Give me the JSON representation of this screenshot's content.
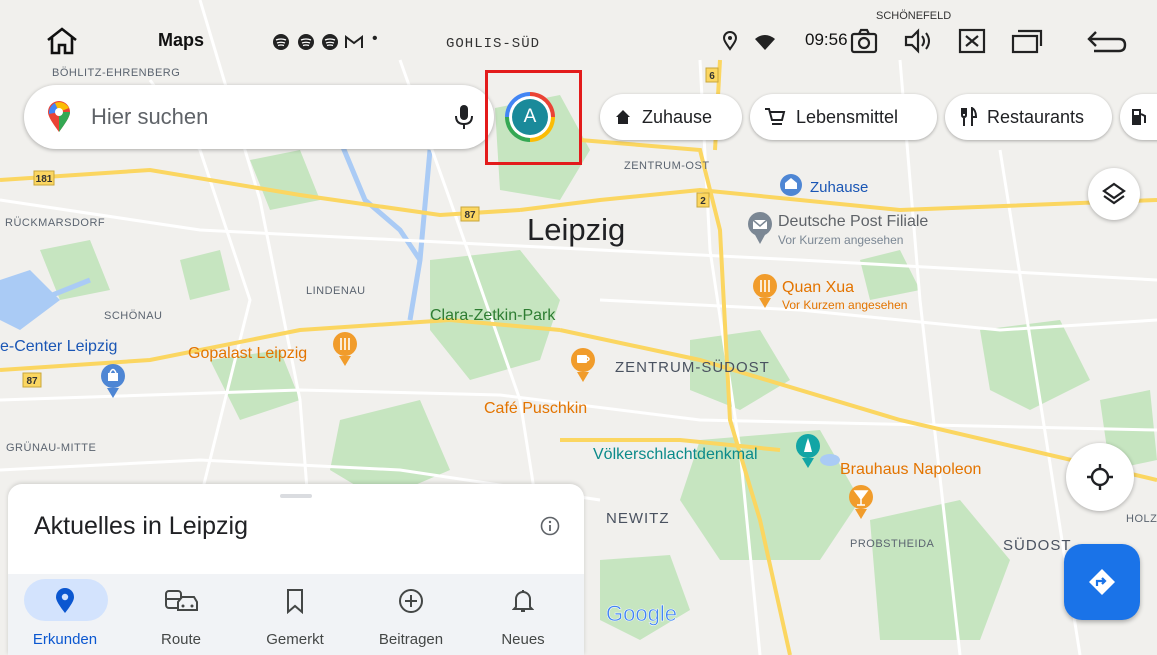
{
  "status_bar": {
    "app_title": "Maps",
    "time": "09:56",
    "icons": [
      "home-icon",
      "spotify-icon",
      "spotify-icon",
      "spotify-icon",
      "gmail-icon",
      "location-icon",
      "wifi-icon",
      "screenshot-icon",
      "volume-icon",
      "close-box-icon",
      "window-icon",
      "back-icon"
    ]
  },
  "search": {
    "placeholder": "Hier suchen"
  },
  "avatar": {
    "initial": "A"
  },
  "chips": [
    {
      "label": "Zuhause",
      "icon": "home-icon"
    },
    {
      "label": "Lebensmittel",
      "icon": "cart-icon"
    },
    {
      "label": "Restaurants",
      "icon": "restaurant-icon"
    }
  ],
  "map": {
    "labels": {
      "boehlitz": "BÖHLITZ-EHRENBERG",
      "gohlis": "GOHLIS-SÜD",
      "schoenefeld": "SCHÖNEFELD",
      "rueckmarsdorf": "RÜCKMARSDORF",
      "zentrum_ost": "ZENTRUM-OST",
      "leipzig": "Leipzig",
      "lindenau": "LINDENAU",
      "schoenau": "SCHÖNAU",
      "clara": "Clara-Zetkin-Park",
      "zentrum_suedost": "ZENTRUM-SÜDOST",
      "gruenau": "GRÜNAU-MITTE",
      "newitz": "NEWITZ",
      "probstheida": "PROBSTHEIDA",
      "suedost": "SÜDOST",
      "holz": "HOLZ",
      "google": "Google"
    },
    "road_numbers": {
      "r181": "181",
      "r87a": "87",
      "r87b": "87",
      "r6": "6",
      "r2": "2"
    },
    "places": {
      "zuhause": "Zuhause",
      "post_name": "Deutsche Post Filiale",
      "post_sub": "Vor Kurzem angesehen",
      "quan_name": "Quan Xua",
      "quan_sub": "Vor Kurzem angesehen",
      "center": "e-Center Leipzig",
      "gopalast": "Gopalast Leipzig",
      "cafe": "Café Puschkin",
      "voelker": "Völkerschlachtdenkmal",
      "brauhaus": "Brauhaus Napoleon"
    },
    "colors": {
      "water": "#aacbf5",
      "park": "#c4e3bf",
      "road_major": "#fbd661",
      "road": "#ffffff",
      "food_pin": "#f19c2b",
      "blue_pin": "#4e86d4"
    }
  },
  "sheet": {
    "title": "Aktuelles in Leipzig"
  },
  "bottom_nav": [
    {
      "label": "Erkunden",
      "icon": "explore-pin-icon",
      "active": true
    },
    {
      "label": "Route",
      "icon": "commute-icon",
      "active": false
    },
    {
      "label": "Gemerkt",
      "icon": "bookmark-icon",
      "active": false
    },
    {
      "label": "Beitragen",
      "icon": "add-circle-icon",
      "active": false
    },
    {
      "label": "Neues",
      "icon": "bell-icon",
      "active": false
    }
  ]
}
